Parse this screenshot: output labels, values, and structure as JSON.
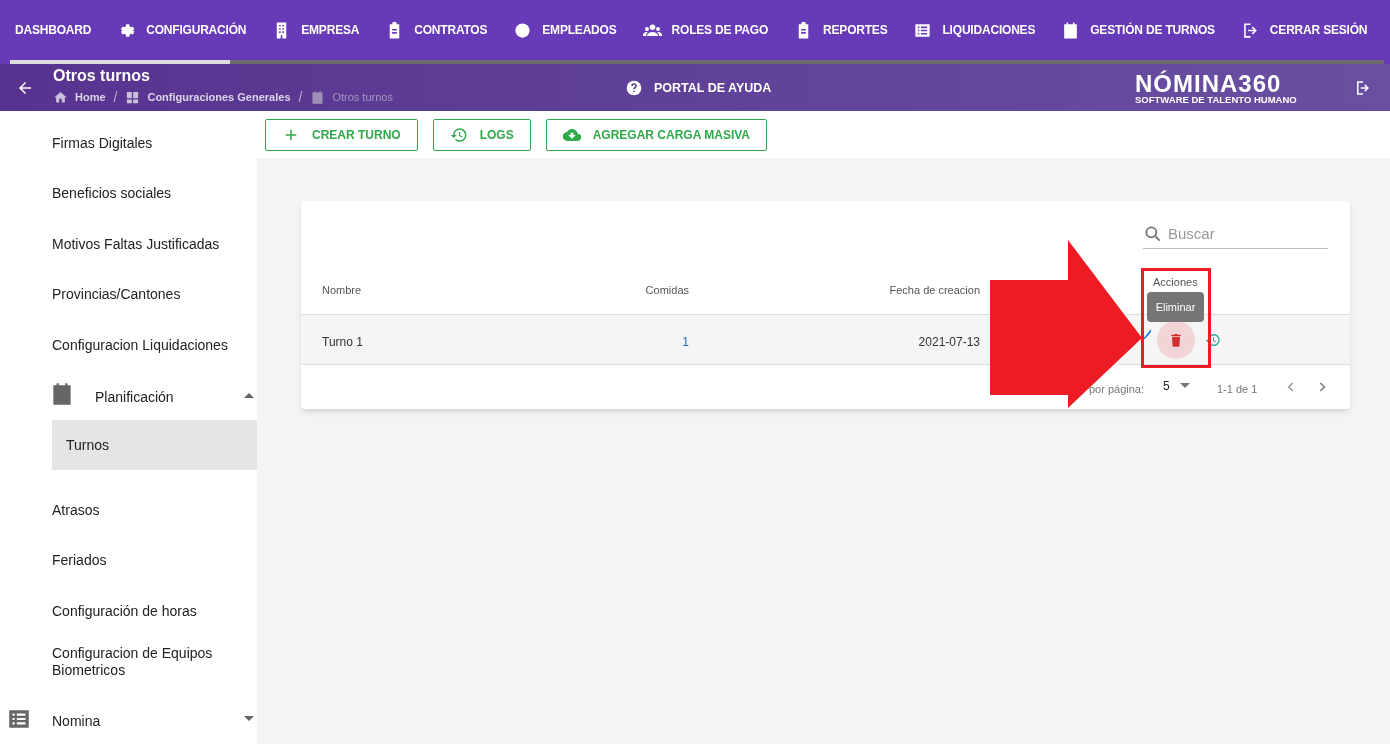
{
  "top_nav": [
    {
      "label": "DASHBOARD"
    },
    {
      "label": "CONFIGURACIÓN"
    },
    {
      "label": "EMPRESA"
    },
    {
      "label": "CONTRATOS"
    },
    {
      "label": "EMPLEADOS"
    },
    {
      "label": "ROLES DE PAGO"
    },
    {
      "label": "REPORTES"
    },
    {
      "label": "LIQUIDACIONES"
    },
    {
      "label": "GESTIÓN DE TURNOS"
    },
    {
      "label": "CERRAR SESIÓN"
    }
  ],
  "header": {
    "title": "Otros turnos",
    "breadcrumb": [
      {
        "label": "Home"
      },
      {
        "separator": "/",
        "label": "Configuraciones Generales"
      },
      {
        "separator": "/",
        "label": "Otros turnos"
      }
    ],
    "help": "PORTAL DE AYUDA",
    "logo": "NÓMINA360",
    "logo_tagline": "SOFTWARE DE TALENTO HUMANO"
  },
  "sidebar": {
    "items": [
      {
        "label": "Firmas Digitales",
        "kind": "link",
        "selected": false
      },
      {
        "label": "Beneficios sociales",
        "kind": "link",
        "selected": false
      },
      {
        "label": "Motivos Faltas Justificadas",
        "kind": "link",
        "selected": false
      },
      {
        "label": "Provincias/Cantones",
        "kind": "link",
        "selected": false
      },
      {
        "label": "Configuracion Liquidaciones",
        "kind": "link",
        "selected": false
      },
      {
        "label": "Planificación",
        "kind": "group",
        "expanded": true,
        "children": [
          {
            "label": "Turnos",
            "selected": true
          }
        ]
      },
      {
        "label": "Atrasos",
        "kind": "link",
        "selected": false
      },
      {
        "label": "Feriados",
        "kind": "link",
        "selected": false
      },
      {
        "label": "Configuración de horas",
        "kind": "link",
        "selected": false
      },
      {
        "label": "Configuracion de Equipos Biometricos",
        "kind": "link",
        "selected": false
      },
      {
        "label": "Nomina",
        "kind": "group",
        "expanded": false
      }
    ]
  },
  "toolbar": [
    {
      "label": "CREAR TURNO"
    },
    {
      "label": "LOGS"
    },
    {
      "label": "AGREGAR CARGA MASIVA"
    }
  ],
  "table": {
    "search": {
      "placeholder": "Buscar"
    },
    "columns": [
      "Nombre",
      "Comidas",
      "Fecha de creacion",
      "Acciones"
    ],
    "rows": [
      {
        "cells": [
          "Turno 1",
          "1",
          "2021-07-13"
        ]
      }
    ],
    "tooltip": "Eliminar",
    "pagination": {
      "rows_label": "por página:",
      "rows_per_page": "5",
      "range": "1-1 de 1"
    }
  }
}
